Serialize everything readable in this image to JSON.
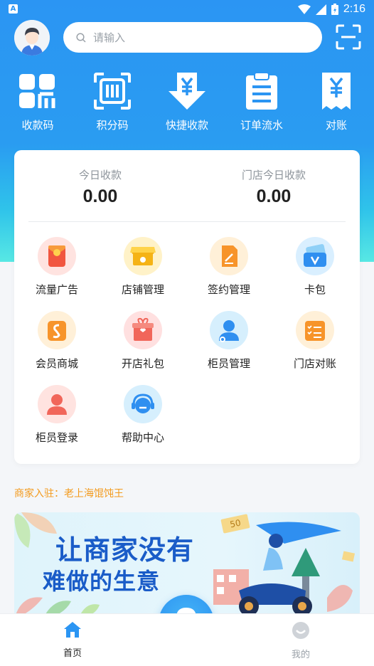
{
  "status_bar": {
    "badge": "A",
    "time": "2:16"
  },
  "header": {
    "search_placeholder": "请输入"
  },
  "top_actions": [
    {
      "label": "收款码",
      "icon": "qr-code-icon"
    },
    {
      "label": "积分码",
      "icon": "barcode-scan-icon"
    },
    {
      "label": "快捷收款",
      "icon": "yuan-download-icon"
    },
    {
      "label": "订单流水",
      "icon": "clipboard-list-icon"
    },
    {
      "label": "对账",
      "icon": "yuan-receipt-icon"
    }
  ],
  "stats": {
    "today": {
      "label": "今日收款",
      "value": "0.00"
    },
    "store_today": {
      "label": "门店今日收款",
      "value": "0.00"
    }
  },
  "grid": [
    {
      "label": "流量广告",
      "icon": "red-envelope-icon"
    },
    {
      "label": "店铺管理",
      "icon": "store-icon"
    },
    {
      "label": "签约管理",
      "icon": "contract-icon"
    },
    {
      "label": "卡包",
      "icon": "card-wallet-icon"
    },
    {
      "label": "会员商城",
      "icon": "shopping-bag-icon"
    },
    {
      "label": "开店礼包",
      "icon": "gift-box-icon"
    },
    {
      "label": "柜员管理",
      "icon": "staff-settings-icon"
    },
    {
      "label": "门店对账",
      "icon": "checklist-icon"
    },
    {
      "label": "柜员登录",
      "icon": "user-login-icon"
    },
    {
      "label": "帮助中心",
      "icon": "headset-icon"
    }
  ],
  "notice": "商家入驻：老上海馄饨王",
  "banner": {
    "line1": "让商家没有",
    "line2": "难做的生意",
    "coin_text": "50"
  },
  "bottom_nav": {
    "home": {
      "label": "首页"
    },
    "mine": {
      "label": "我的"
    }
  },
  "colors": {
    "primary": "#2b95f3",
    "accent_orange": "#f39a1c"
  }
}
